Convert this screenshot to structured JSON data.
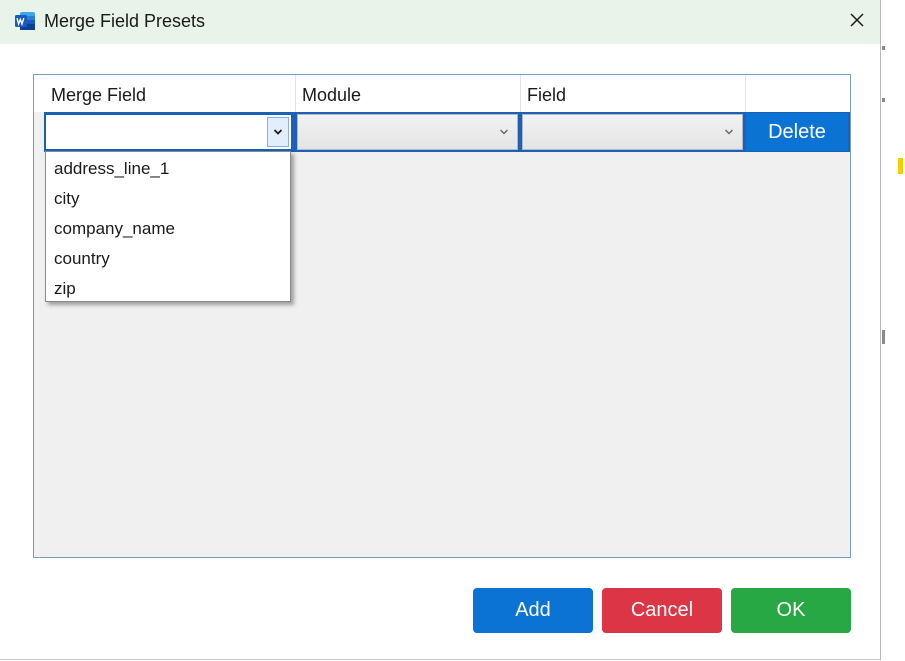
{
  "window": {
    "title": "Merge Field Presets",
    "app_icon": "word-icon",
    "close_icon": "close-icon"
  },
  "grid": {
    "columns": [
      "Merge Field",
      "Module",
      "Field",
      ""
    ],
    "row": {
      "merge_field_value": "",
      "module_value": "",
      "field_value": "",
      "delete_label": "Delete"
    }
  },
  "dropdown": {
    "options": [
      "address_line_1",
      "city",
      "company_name",
      "country",
      "zip"
    ]
  },
  "footer": {
    "add_label": "Add",
    "cancel_label": "Cancel",
    "ok_label": "OK"
  },
  "colors": {
    "titlebar_bg": "#e8f4e9",
    "add": "#0a73d4",
    "cancel": "#dc3545",
    "ok": "#28a745",
    "delete": "#0a73d4",
    "selection": "#1f5fb4"
  }
}
